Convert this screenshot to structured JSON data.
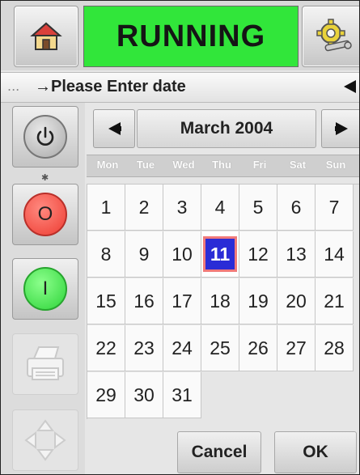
{
  "header": {
    "status_text": "RUNNING",
    "status_color": "#31e63a"
  },
  "prompt": {
    "dots": "...",
    "text": "→Please Enter date"
  },
  "icons": {
    "home": "home-icon",
    "settings": "gear-wrench-icon",
    "power": "power-icon",
    "stop": "stop-icon",
    "start": "start-icon",
    "printer": "printer-icon",
    "move": "directional-pad-icon"
  },
  "rail": {
    "stop_label": "O",
    "start_label": "I"
  },
  "calendar": {
    "month_label": "March 2004",
    "weekdays": [
      "Mon",
      "Tue",
      "Wed",
      "Thu",
      "Fri",
      "Sat",
      "Sun"
    ],
    "days": [
      [
        "1",
        "2",
        "3",
        "4",
        "5",
        "6",
        "7"
      ],
      [
        "8",
        "9",
        "10",
        "11",
        "12",
        "13",
        "14"
      ],
      [
        "15",
        "16",
        "17",
        "18",
        "19",
        "20",
        "21"
      ],
      [
        "22",
        "23",
        "24",
        "25",
        "26",
        "27",
        "28"
      ],
      [
        "29",
        "30",
        "31",
        "",
        "",
        "",
        ""
      ]
    ],
    "selected_day": "11",
    "selected_color": "#2a2cd6"
  },
  "actions": {
    "cancel_label": "Cancel",
    "ok_label": "OK"
  }
}
